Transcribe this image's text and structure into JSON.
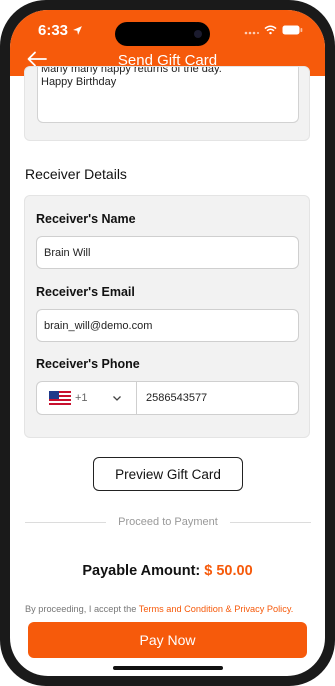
{
  "status_bar": {
    "time": "6:33"
  },
  "header": {
    "title": "Send Gift Card"
  },
  "message": {
    "line1": "Many many happy returns of the day.",
    "line2": "Happy Birthday"
  },
  "receiver": {
    "section_title": "Receiver Details",
    "name_label": "Receiver's Name",
    "name_value": "Brain Will",
    "email_label": "Receiver's Email",
    "email_value": "brain_will@demo.com",
    "phone_label": "Receiver's Phone",
    "country_code": "+1",
    "country_flag": "us-flag-icon",
    "phone_value": "2586543577"
  },
  "preview_button": "Preview Gift Card",
  "divider_text": "Proceed to Payment",
  "payment": {
    "label": "Payable Amount:",
    "amount": "$ 50.00"
  },
  "terms": {
    "prefix": "By proceeding, I accept the ",
    "link": "Terms and Condition & Privacy Policy."
  },
  "pay_button": "Pay Now",
  "colors": {
    "accent": "#f65a0b",
    "card_bg": "#f2f2f2"
  }
}
